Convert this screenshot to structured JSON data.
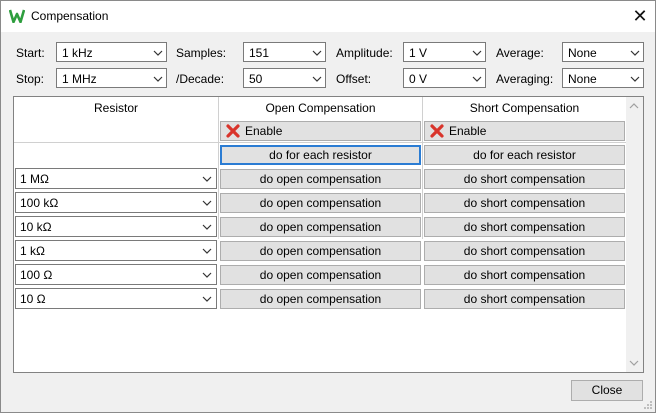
{
  "window": {
    "title": "Compensation",
    "icon": "app-w-logo-icon",
    "close_glyph": "✕",
    "close_label": "Close"
  },
  "settings": {
    "start_label": "Start:",
    "start_value": "1 kHz",
    "stop_label": "Stop:",
    "stop_value": "1 MHz",
    "samples_label": "Samples:",
    "samples_value": "151",
    "decade_label": "/Decade:",
    "decade_value": "50",
    "amplitude_label": "Amplitude:",
    "amplitude_value": "1 V",
    "offset_label": "Offset:",
    "offset_value": "0 V",
    "average_label": "Average:",
    "average_value": "None",
    "averaging_label": "Averaging:",
    "averaging_value": "None"
  },
  "grid": {
    "col_resistor": "Resistor",
    "col_open": "Open Compensation",
    "col_short": "Short Compensation",
    "enable_label": "Enable",
    "each_label": "do for each resistor",
    "open_btn_label": "do open compensation",
    "short_btn_label": "do short compensation",
    "resistors": [
      "1 MΩ",
      "100 kΩ",
      "10 kΩ",
      "1 kΩ",
      "100 Ω",
      "10 Ω"
    ]
  },
  "colors": {
    "accent": "#2b7cd3",
    "disable_red": "#d9342b",
    "logo_green": "#2e9e3e"
  }
}
